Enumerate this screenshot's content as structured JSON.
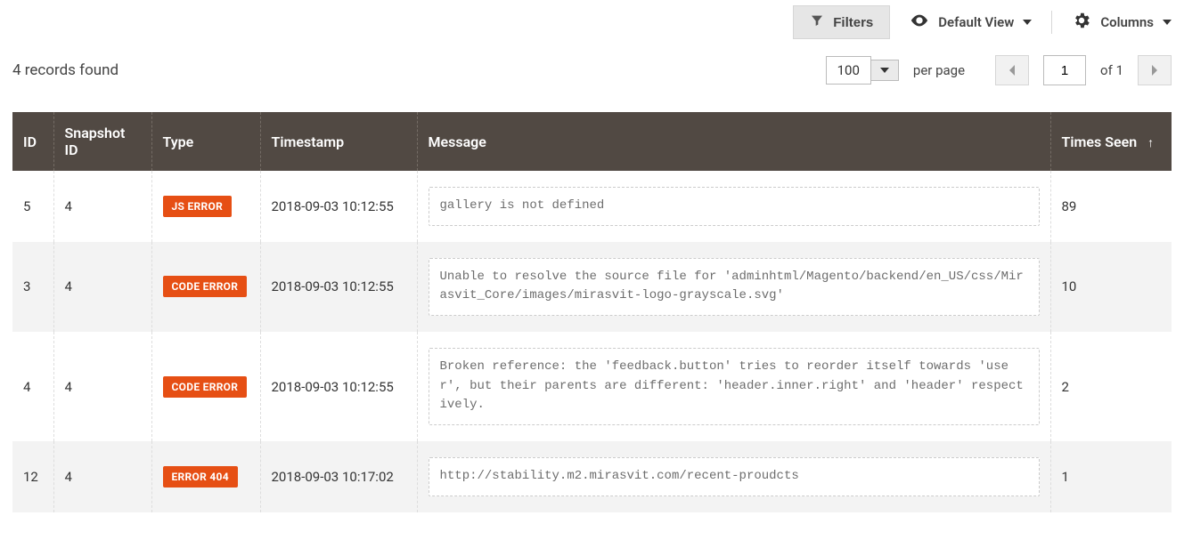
{
  "toolbar": {
    "filters_label": "Filters",
    "default_view_label": "Default View",
    "columns_label": "Columns"
  },
  "summary": {
    "records_found": "4 records found"
  },
  "pager": {
    "page_size": "100",
    "per_page_label": "per page",
    "current_page": "1",
    "of_label": "of",
    "total_pages": "1"
  },
  "columns": {
    "id": "ID",
    "snapshot_id": "Snapshot ID",
    "type": "Type",
    "timestamp": "Timestamp",
    "message": "Message",
    "times_seen": "Times Seen"
  },
  "sort": {
    "indicator": "↑"
  },
  "rows": [
    {
      "id": "5",
      "snapshot_id": "4",
      "type": "JS ERROR",
      "timestamp": "2018-09-03 10:12:55",
      "message": "gallery is not defined",
      "times_seen": "89"
    },
    {
      "id": "3",
      "snapshot_id": "4",
      "type": "CODE ERROR",
      "timestamp": "2018-09-03 10:12:55",
      "message": "Unable to resolve the source file for 'adminhtml/Magento/backend/en_US/css/Mirasvit_Core/images/mirasvit-logo-grayscale.svg'",
      "times_seen": "10"
    },
    {
      "id": "4",
      "snapshot_id": "4",
      "type": "CODE ERROR",
      "timestamp": "2018-09-03 10:12:55",
      "message": "Broken reference: the 'feedback.button' tries to reorder itself towards 'user', but their parents are different: 'header.inner.right' and 'header' respectively.",
      "times_seen": "2"
    },
    {
      "id": "12",
      "snapshot_id": "4",
      "type": "ERROR 404",
      "timestamp": "2018-09-03 10:17:02",
      "message": "http://stability.m2.mirasvit.com/recent-proudcts",
      "times_seen": "1"
    }
  ]
}
